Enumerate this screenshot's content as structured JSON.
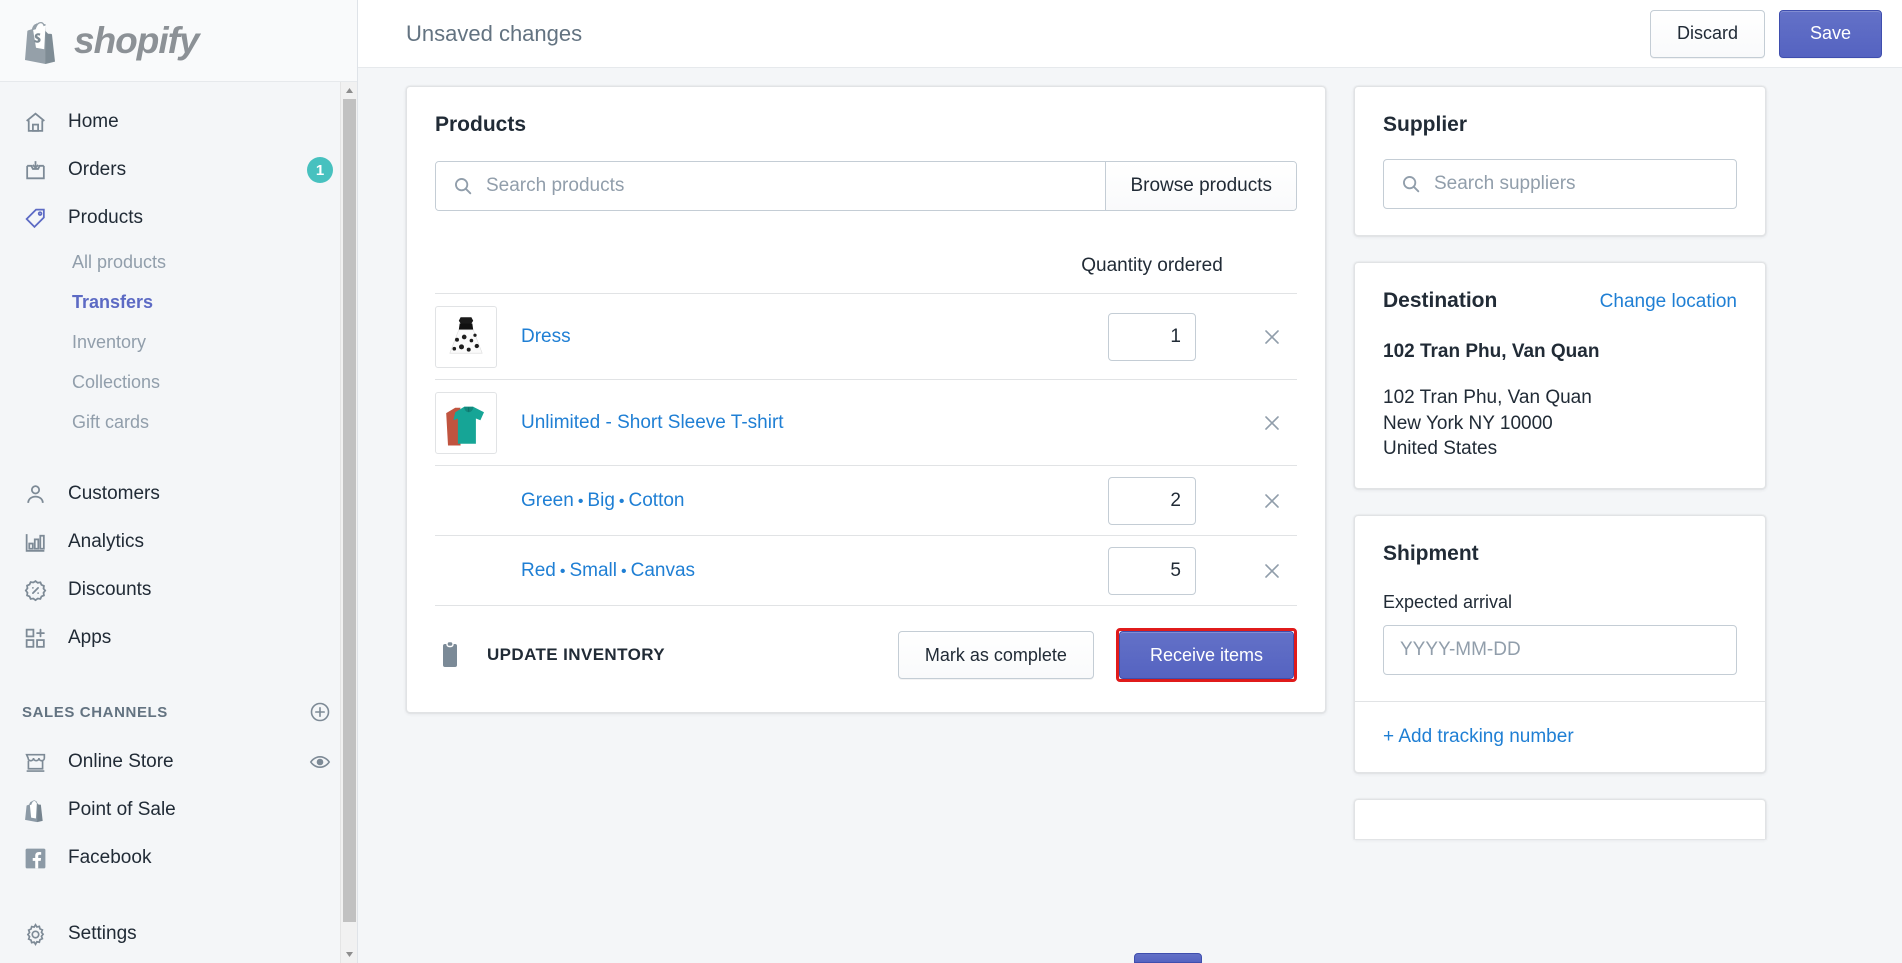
{
  "brand": {
    "name": "shopify",
    "logo_icon": "shopify-bag-logo"
  },
  "topbar": {
    "title": "Unsaved changes",
    "discard_label": "Discard",
    "save_label": "Save",
    "save_color": "#5c6ac4"
  },
  "sidebar": {
    "items": [
      {
        "label": "Home",
        "icon": "home-icon",
        "badge": ""
      },
      {
        "label": "Orders",
        "icon": "orders-inbox-icon",
        "badge": "1"
      },
      {
        "label": "Products",
        "icon": "products-tag-icon",
        "badge": ""
      }
    ],
    "product_subitems": [
      {
        "label": "All products",
        "active": false
      },
      {
        "label": "Transfers",
        "active": true
      },
      {
        "label": "Inventory",
        "active": false
      },
      {
        "label": "Collections",
        "active": false
      },
      {
        "label": "Gift cards",
        "active": false
      }
    ],
    "items2": [
      {
        "label": "Customers",
        "icon": "person-icon"
      },
      {
        "label": "Analytics",
        "icon": "bar-chart-icon"
      },
      {
        "label": "Discounts",
        "icon": "discount-percent-icon"
      },
      {
        "label": "Apps",
        "icon": "apps-grid-icon"
      }
    ],
    "sales_channels_label": "SALES CHANNELS",
    "sales_channels_add_icon": "plus-circle-icon",
    "channels": [
      {
        "label": "Online Store",
        "icon": "storefront-icon",
        "trailing_icon": "eye-icon"
      },
      {
        "label": "Point of Sale",
        "icon": "shopify-bag-icon",
        "trailing_icon": ""
      },
      {
        "label": "Facebook",
        "icon": "facebook-icon",
        "trailing_icon": ""
      }
    ],
    "settings": {
      "label": "Settings",
      "icon": "gear-icon"
    },
    "badge_color": "#47c1bf",
    "active_color": "#5c6ac4"
  },
  "products_card": {
    "title": "Products",
    "search_placeholder": "Search products",
    "search_value": "",
    "search_icon": "search-icon",
    "browse_label": "Browse products",
    "quantity_header": "Quantity ordered",
    "rows": [
      {
        "type": "product",
        "name": "Dress",
        "thumb_icon": "dress-thumbnail",
        "quantity": "1",
        "has_quantity": true,
        "remove_icon": "close-icon"
      },
      {
        "type": "product",
        "name": "Unlimited - Short Sleeve T-shirt",
        "thumb_icon": "tshirt-thumbnail",
        "quantity": "",
        "has_quantity": false,
        "remove_icon": "close-icon"
      },
      {
        "type": "variant",
        "options": [
          "Green",
          "Big",
          "Cotton"
        ],
        "separator": "•",
        "quantity": "2",
        "has_quantity": true,
        "remove_icon": "close-icon"
      },
      {
        "type": "variant",
        "options": [
          "Red",
          "Small",
          "Canvas"
        ],
        "separator": "•",
        "quantity": "5",
        "has_quantity": true,
        "remove_icon": "close-icon"
      }
    ],
    "footer": {
      "icon": "clipboard-icon",
      "label": "UPDATE INVENTORY",
      "mark_complete_label": "Mark as complete",
      "receive_items_label": "Receive items",
      "highlight_color": "#e01b1b"
    }
  },
  "supplier_card": {
    "title": "Supplier",
    "search_placeholder": "Search suppliers",
    "search_value": "",
    "search_icon": "search-icon"
  },
  "destination_card": {
    "title": "Destination",
    "change_location_label": "Change location",
    "location_name": "102 Tran Phu, Van Quan",
    "address_lines": [
      "102 Tran Phu, Van Quan",
      "New York NY 10000",
      "United States"
    ]
  },
  "shipment_card": {
    "title": "Shipment",
    "expected_arrival_label": "Expected arrival",
    "expected_arrival_placeholder": "YYYY-MM-DD",
    "expected_arrival_value": "",
    "add_tracking_label": "+ Add tracking number"
  }
}
